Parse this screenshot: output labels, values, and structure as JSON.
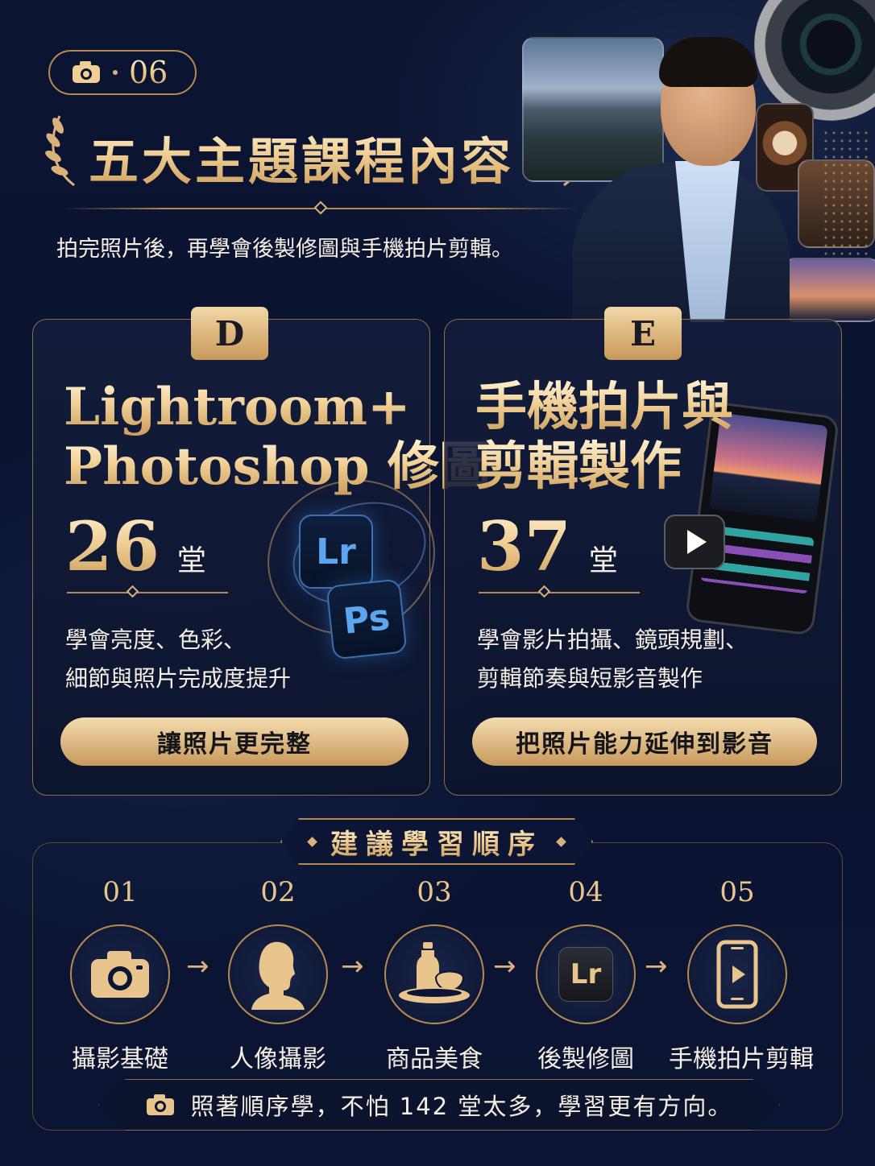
{
  "header": {
    "lesson_number": "06",
    "title": "五大主題課程內容",
    "subtitle": "拍完照片後，再學會後製修圖與手機拍片剪輯。"
  },
  "cards": [
    {
      "tag": "D",
      "title_line1": "Lightroom+",
      "title_line2": "Photoshop 修圖",
      "count": "26",
      "unit": "堂",
      "desc_line1": "學會亮度、色彩、",
      "desc_line2": "細節與照片完成度提升",
      "button": "讓照片更完整",
      "icons": [
        "Lr",
        "Ps"
      ]
    },
    {
      "tag": "E",
      "title_line1": "手機拍片與",
      "title_line2": "剪輯製作",
      "count": "37",
      "unit": "堂",
      "desc_line1": "學會影片拍攝、鏡頭規劃、",
      "desc_line2": "剪輯節奏與短影音製作",
      "button": "把照片能力延伸到影音"
    }
  ],
  "order": {
    "title": "建議學習順序",
    "arrow": "→",
    "steps": [
      {
        "num": "01",
        "label": "攝影基礎",
        "icon": "camera-icon"
      },
      {
        "num": "02",
        "label": "人像攝影",
        "icon": "portrait-silhouette-icon"
      },
      {
        "num": "03",
        "label": "商品美食",
        "icon": "food-product-icon"
      },
      {
        "num": "04",
        "label": "後製修圖",
        "icon": "lightroom-icon",
        "icon_text": "Lr"
      },
      {
        "num": "05",
        "label": "手機拍片剪輯",
        "icon": "phone-video-icon"
      }
    ],
    "footer": "照著順序學，不怕 142 堂太多，學習更有方向。"
  },
  "colors": {
    "background": "#0b1430",
    "gold": "#d8b27a",
    "gold_light": "#f4dcae",
    "text": "#f6efe3"
  }
}
